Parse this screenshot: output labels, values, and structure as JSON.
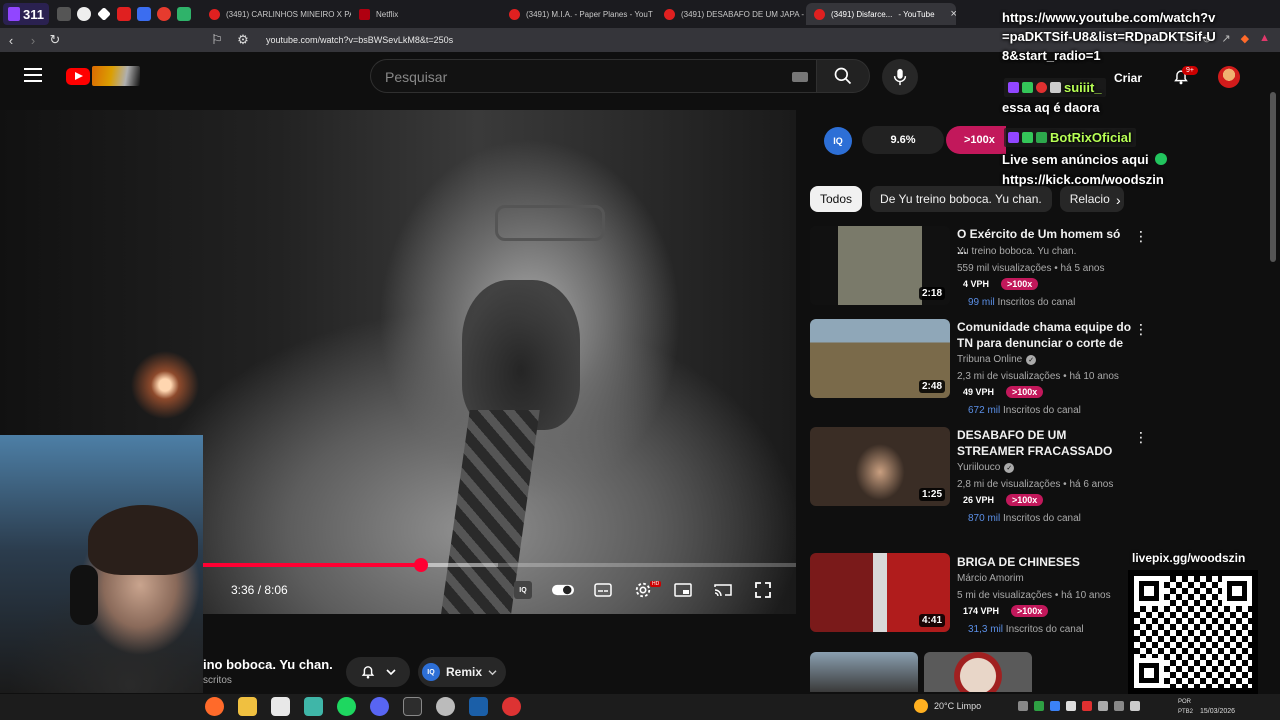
{
  "browser": {
    "twitch_count": "311",
    "tabs": [
      {
        "title": "(3491) CARLINHOS MINEIRO X PA"
      },
      {
        "title": "Netflix"
      },
      {
        "title": "(3491) M.I.A. - Paper Planes - YouT"
      },
      {
        "title": "(3491) DESABAFO DE UM JAPA -"
      },
      {
        "title": "(3491) Disfarce...",
        "suffix": "- YouTube",
        "active": true
      }
    ],
    "url": "youtube.com/watch?v=bsBWSevLkM8&t=250s"
  },
  "youtube": {
    "search_placeholder": "Pesquisar",
    "create_label": "Criar",
    "notification_badge": "9+",
    "player": {
      "time": "3:36 / 8:06",
      "progress": 0.37,
      "buffered": 0.5
    },
    "below_video": {
      "channel": "ino boboca. Yu chan.",
      "subs_label": "scritos",
      "remix_label": "Remix",
      "iq_label": "IQ"
    },
    "extension": {
      "iq_label": "IQ",
      "percent": "9.6%",
      "multiplier": ">100x"
    },
    "chips": [
      "Todos",
      "De Yu treino boboca. Yu chan.",
      "Relacio"
    ],
    "recommendations": [
      {
        "title": "O Exército de Um homem só ...",
        "channel": "Yu treino boboca. Yu chan.",
        "verified": false,
        "meta": "559 mil visualizações • há 5 anos",
        "duration": "2:18",
        "vph": "4 VPH",
        "mult": ">100x",
        "subs_num": "99 mil",
        "subs_text": "Inscritos do canal"
      },
      {
        "title": "Comunidade chama equipe do TN para denunciar o corte de ...",
        "channel": "Tribuna Online",
        "verified": true,
        "meta": "2,3 mi de visualizações • há 10 anos",
        "duration": "2:48",
        "vph": "49 VPH",
        "mult": ">100x",
        "subs_num": "672 mil",
        "subs_text": "Inscritos do canal"
      },
      {
        "title": "DESABAFO DE UM STREAMER FRACASSADO (MANDA FOTO ...",
        "channel": "Yuriilouco",
        "verified": true,
        "meta": "2,8 mi de visualizações • há 6 anos",
        "duration": "1:25",
        "vph": "26 VPH",
        "mult": ">100x",
        "subs_num": "870 mil",
        "subs_text": "Inscritos do canal"
      },
      {
        "title": "BRIGA DE CHINESES",
        "channel": "Márcio Amorim",
        "verified": false,
        "meta": "5 mi de visualizações • há 10 anos",
        "duration": "4:41",
        "vph": "174 VPH",
        "mult": ">100x",
        "subs_num": "31,3 mil",
        "subs_text": "Inscritos do canal"
      }
    ]
  },
  "overlay": {
    "chat_url": "https://www.youtube.com/watch?v=paDKTSif-U8&list=RDpaDKTSif-U8&start_radio=1",
    "chat_user1": "suiiit_",
    "chat_msg1": "essa aq é daora",
    "chat_user2": "BotRixOficial",
    "chat_msg2": "Live sem anúncios aqui",
    "chat_msg3": "https://kick.com/woodszin",
    "qr_label": "livepix.gg/woodszin"
  },
  "taskbar": {
    "weather": "20°C  Limpo",
    "lang1": "POR",
    "lang2": "PTB2",
    "date": "15/03/2026"
  },
  "colors": {
    "youtube_red": "#ff0033",
    "iq_blue": "#2d6fd6",
    "vph_magenta": "#c2185b",
    "subs_blue": "#5b8fe6",
    "chat_username": "#b7ff55"
  }
}
